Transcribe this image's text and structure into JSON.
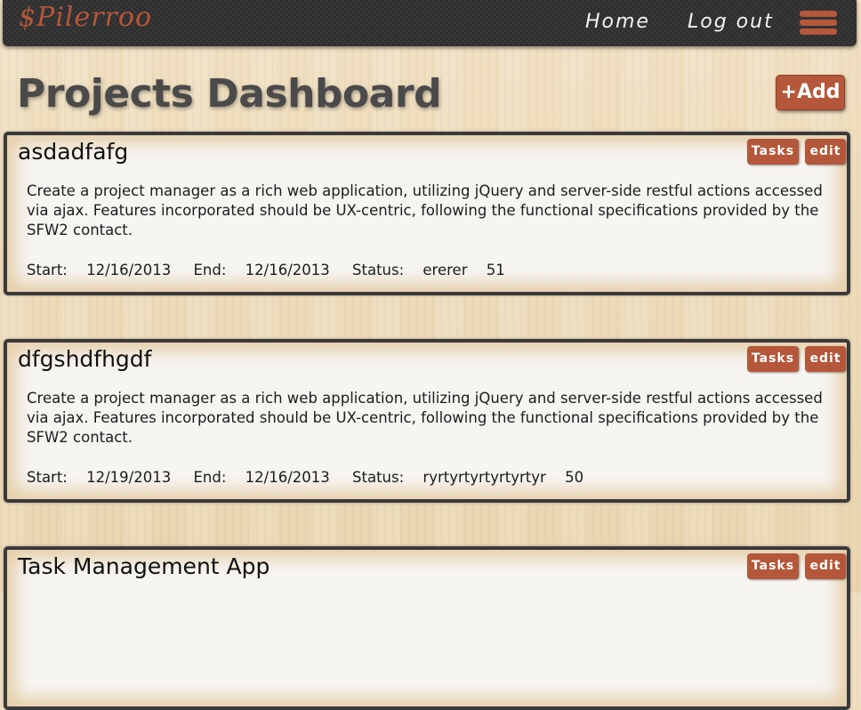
{
  "app": {
    "logo_text": "$Pilerroo"
  },
  "nav": {
    "home": "Home",
    "logout": "Log out"
  },
  "header": {
    "title": "Projects Dashboard",
    "add_label": "+Add"
  },
  "labels": {
    "start": "Start:",
    "end": "End:",
    "status": "Status:",
    "tasks": "Tasks",
    "edit": "edit"
  },
  "colors": {
    "accent": "#b5573a",
    "navbar": "#2f2f2f",
    "card_border": "#3a3a3a"
  },
  "projects": [
    {
      "name": "asdadfafg",
      "description": "Create a project manager as a rich web application, utilizing jQuery and server-side restful actions accessed via ajax. Features incorporated should be UX-centric, following the functional specifications provided by the SFW2 contact.",
      "start": "12/16/2013",
      "end": "12/16/2013",
      "status": "ererer",
      "progress": "51"
    },
    {
      "name": "dfgshdfhgdf",
      "description": "Create a project manager as a rich web application, utilizing jQuery and server-side restful actions accessed via ajax. Features incorporated should be UX-centric, following the functional specifications provided by the SFW2 contact.",
      "start": "12/19/2013",
      "end": "12/16/2013",
      "status": "ryrtyrtyrtyrtyrtyr",
      "progress": "50"
    },
    {
      "name": "Task Management App",
      "description": "",
      "start": "",
      "end": "",
      "status": "",
      "progress": ""
    }
  ]
}
